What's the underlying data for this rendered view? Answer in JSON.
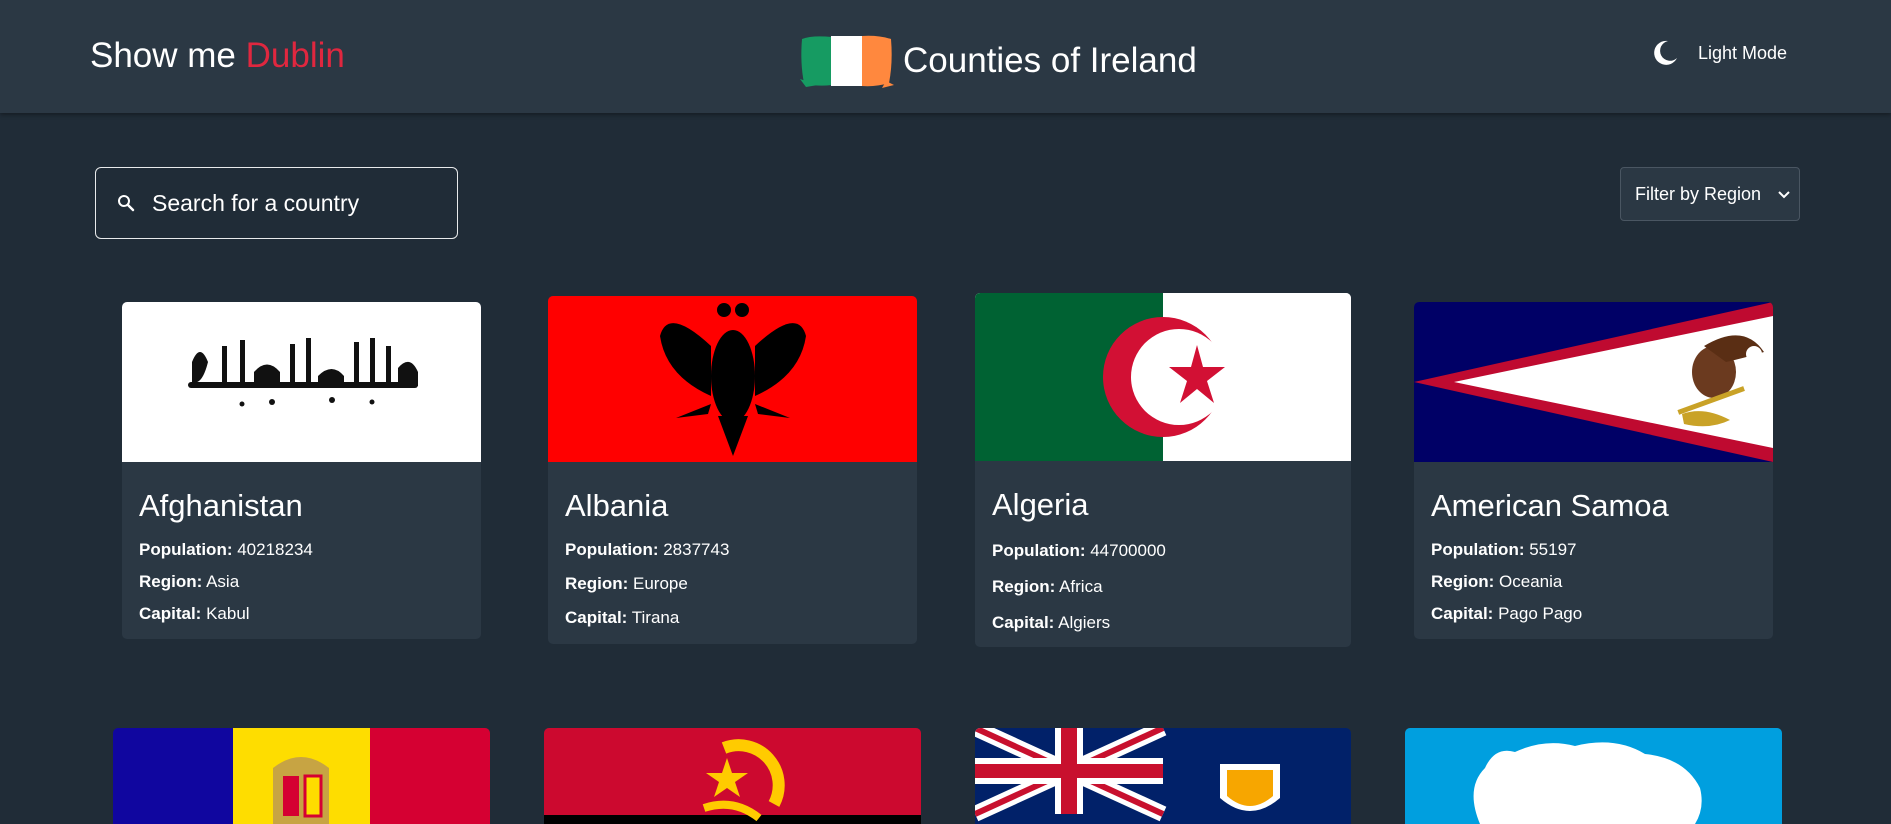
{
  "header": {
    "brand_prefix": "Show me",
    "brand_city": "Dublin",
    "title": "Counties of Ireland",
    "mode_label": "Light Mode"
  },
  "search": {
    "placeholder": "Search for a country"
  },
  "filter": {
    "label": "Filter by Region"
  },
  "labels": {
    "population": "Population:",
    "region": "Region:",
    "capital": "Capital:"
  },
  "countries": [
    {
      "name": "Afghanistan",
      "population": "40218234",
      "region": "Asia",
      "capital": "Kabul"
    },
    {
      "name": "Albania",
      "population": "2837743",
      "region": "Europe",
      "capital": "Tirana"
    },
    {
      "name": "Algeria",
      "population": "44700000",
      "region": "Africa",
      "capital": "Algiers"
    },
    {
      "name": "American Samoa",
      "population": "55197",
      "region": "Oceania",
      "capital": "Pago Pago"
    }
  ],
  "colors": {
    "background": "#202c37",
    "surface": "#2b3844",
    "accent": "#e0273f"
  },
  "icons": [
    "search-icon",
    "moon-icon",
    "chevron-down-icon"
  ]
}
